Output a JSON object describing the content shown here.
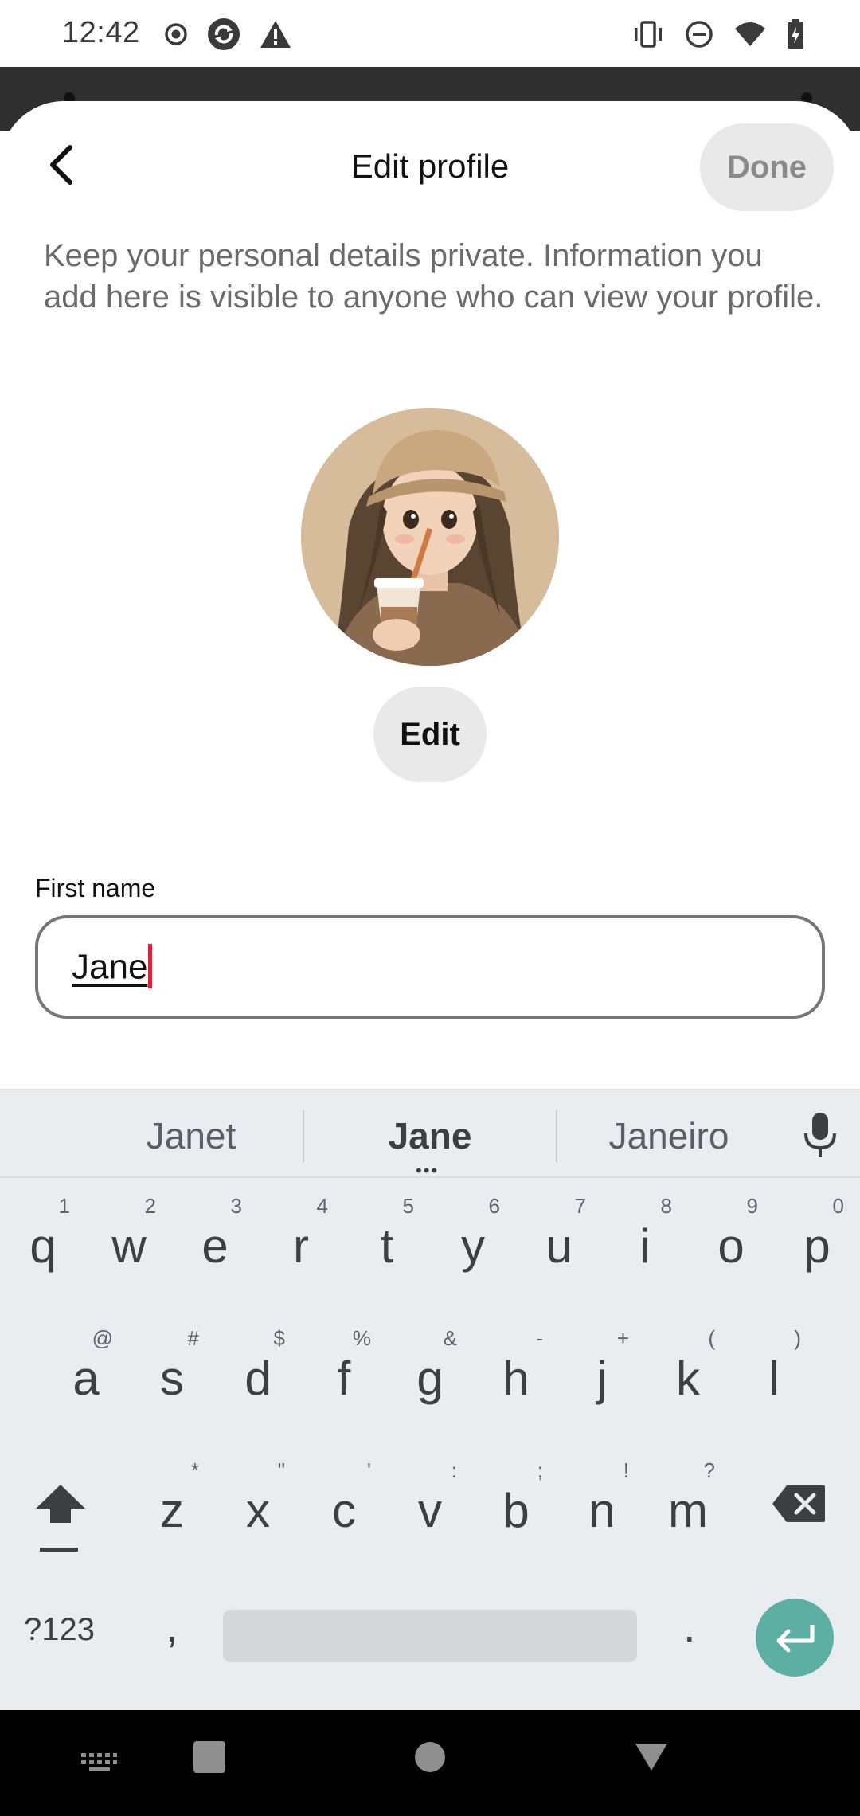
{
  "status_bar": {
    "time": "12:42",
    "icons_left": [
      "record-icon",
      "sync-icon",
      "warning-icon"
    ],
    "icons_right": [
      "vibrate-icon",
      "dnd-icon",
      "wifi-icon",
      "battery-icon"
    ]
  },
  "header": {
    "title": "Edit profile",
    "done_label": "Done"
  },
  "privacy_note": "Keep your personal details private. Information you add here is visible to anyone who can view your profile.",
  "profile": {
    "edit_photo_label": "Edit",
    "first_name_label": "First name",
    "first_name_value": "Jane"
  },
  "keyboard": {
    "suggestions": [
      "Janet",
      "Jane",
      "Janeiro"
    ],
    "row1": [
      {
        "key": "q",
        "hint": "1"
      },
      {
        "key": "w",
        "hint": "2"
      },
      {
        "key": "e",
        "hint": "3"
      },
      {
        "key": "r",
        "hint": "4"
      },
      {
        "key": "t",
        "hint": "5"
      },
      {
        "key": "y",
        "hint": "6"
      },
      {
        "key": "u",
        "hint": "7"
      },
      {
        "key": "i",
        "hint": "8"
      },
      {
        "key": "o",
        "hint": "9"
      },
      {
        "key": "p",
        "hint": "0"
      }
    ],
    "row2": [
      {
        "key": "a",
        "hint": "@"
      },
      {
        "key": "s",
        "hint": "#"
      },
      {
        "key": "d",
        "hint": "$"
      },
      {
        "key": "f",
        "hint": "%"
      },
      {
        "key": "g",
        "hint": "&"
      },
      {
        "key": "h",
        "hint": "-"
      },
      {
        "key": "j",
        "hint": "+"
      },
      {
        "key": "k",
        "hint": "("
      },
      {
        "key": "l",
        "hint": ")"
      }
    ],
    "row3": [
      {
        "key": "z",
        "hint": "*"
      },
      {
        "key": "x",
        "hint": "\""
      },
      {
        "key": "c",
        "hint": "'"
      },
      {
        "key": "v",
        "hint": ":"
      },
      {
        "key": "b",
        "hint": ";"
      },
      {
        "key": "n",
        "hint": "!"
      },
      {
        "key": "m",
        "hint": "?"
      }
    ],
    "symbols_label": "?123",
    "comma": ",",
    "period": ".",
    "accent_color": "#5dafa3"
  },
  "nav_bar": {
    "icons": [
      "keyboard-switch-icon",
      "recents-icon",
      "home-icon",
      "back-icon"
    ]
  }
}
